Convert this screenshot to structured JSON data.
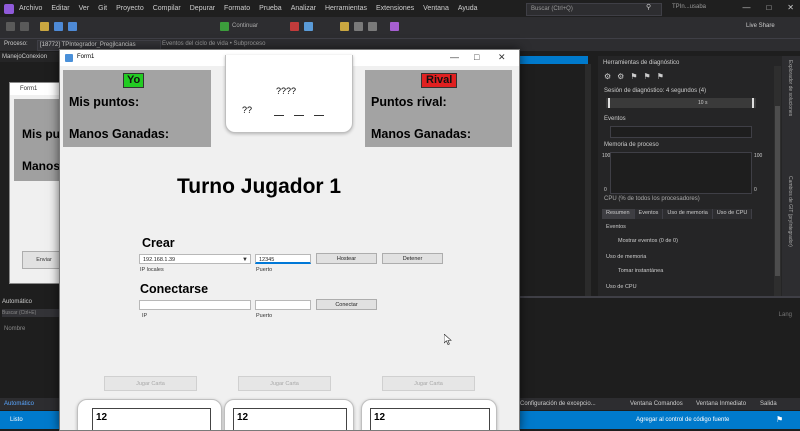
{
  "vs": {
    "menu": [
      "Archivo",
      "Editar",
      "Ver",
      "Git",
      "Proyecto",
      "Compilar",
      "Depurar",
      "Formato",
      "Prueba",
      "Analizar",
      "Herramientas",
      "Extensiones",
      "Ventana",
      "Ayuda"
    ],
    "search_placeholder": "Buscar (Ctrl+Q)",
    "title_text": "TPIn...usaba",
    "live_share": "Live Share",
    "toolbar_continue": "Continuar",
    "process_label": "Proceso:",
    "process_value": "[18772] TPIntegrador_Pregjlcancias",
    "process_events": "Eventos del ciclo de vida • Subproceso",
    "left_tab": "ManejoConexion",
    "right_strip": [
      "Explorador de soluciones",
      "Cambios de GIT (pryIntegrador)"
    ],
    "status_ready": "Listo",
    "status_source_control": "Agregar al control de código fuente",
    "bottom_tabs": [
      "Automático",
      "Configuración de excepcio...",
      "Ventana Comandos",
      "Ventana Inmediato",
      "Salida"
    ]
  },
  "diag": {
    "title": "Herramientas de diagnóstico",
    "session": "Sesión de diagnóstico: 4 segundos (4)",
    "timeline_label": "10 s",
    "events_label": "Eventos",
    "memory_label": "Memoria de proceso",
    "cpu_label": "CPU (% de todos los procesadores)",
    "mem_max": "100",
    "mem_min": "0",
    "tabs": [
      "Resumen",
      "Eventos",
      "Uso de memoria",
      "Uso de CPU"
    ],
    "section_events": "Eventos",
    "show_events": "Mostrar eventos (0 de 0)",
    "section_memory": "Uso de memoria",
    "snapshot": "Tomar instantánea",
    "section_cpu": "Uso de CPU"
  },
  "output": {
    "left_header": "Automático",
    "left_search": "Buscar (Ctrl+E)",
    "left_name": "Nombre",
    "right_link": "Lang"
  },
  "bg_form": {
    "title": "Form1",
    "label1": "Mis pu",
    "label2": "Manos",
    "button": "Enviar"
  },
  "form": {
    "title": "Form1",
    "me_badge": "Yo",
    "rival_badge": "Rival",
    "my_points_label": "Mis puntos:",
    "my_hands_label": "Manos Ganadas:",
    "rival_points_label": "Puntos rival:",
    "rival_hands_label": "Manos Ganadas:",
    "top_card_value": "????",
    "top_card_corner": "??",
    "turn_title": "Turno Jugador 1",
    "create_title": "Crear",
    "ip_value": "192.168.1.39",
    "ip_hint": "IP locales",
    "port_value": "12345",
    "port_hint": "Puerto",
    "host_button": "Hostear",
    "stop_button": "Detener",
    "connect_title": "Conectarse",
    "connect_ip_hint": "IP",
    "connect_port_hint": "Puerto",
    "connect_button": "Conectar",
    "play_card_buttons": [
      "Jugar Carta",
      "Jugar Carta",
      "Jugar Carta"
    ],
    "hand_card_values": [
      "12",
      "12",
      "12"
    ]
  }
}
